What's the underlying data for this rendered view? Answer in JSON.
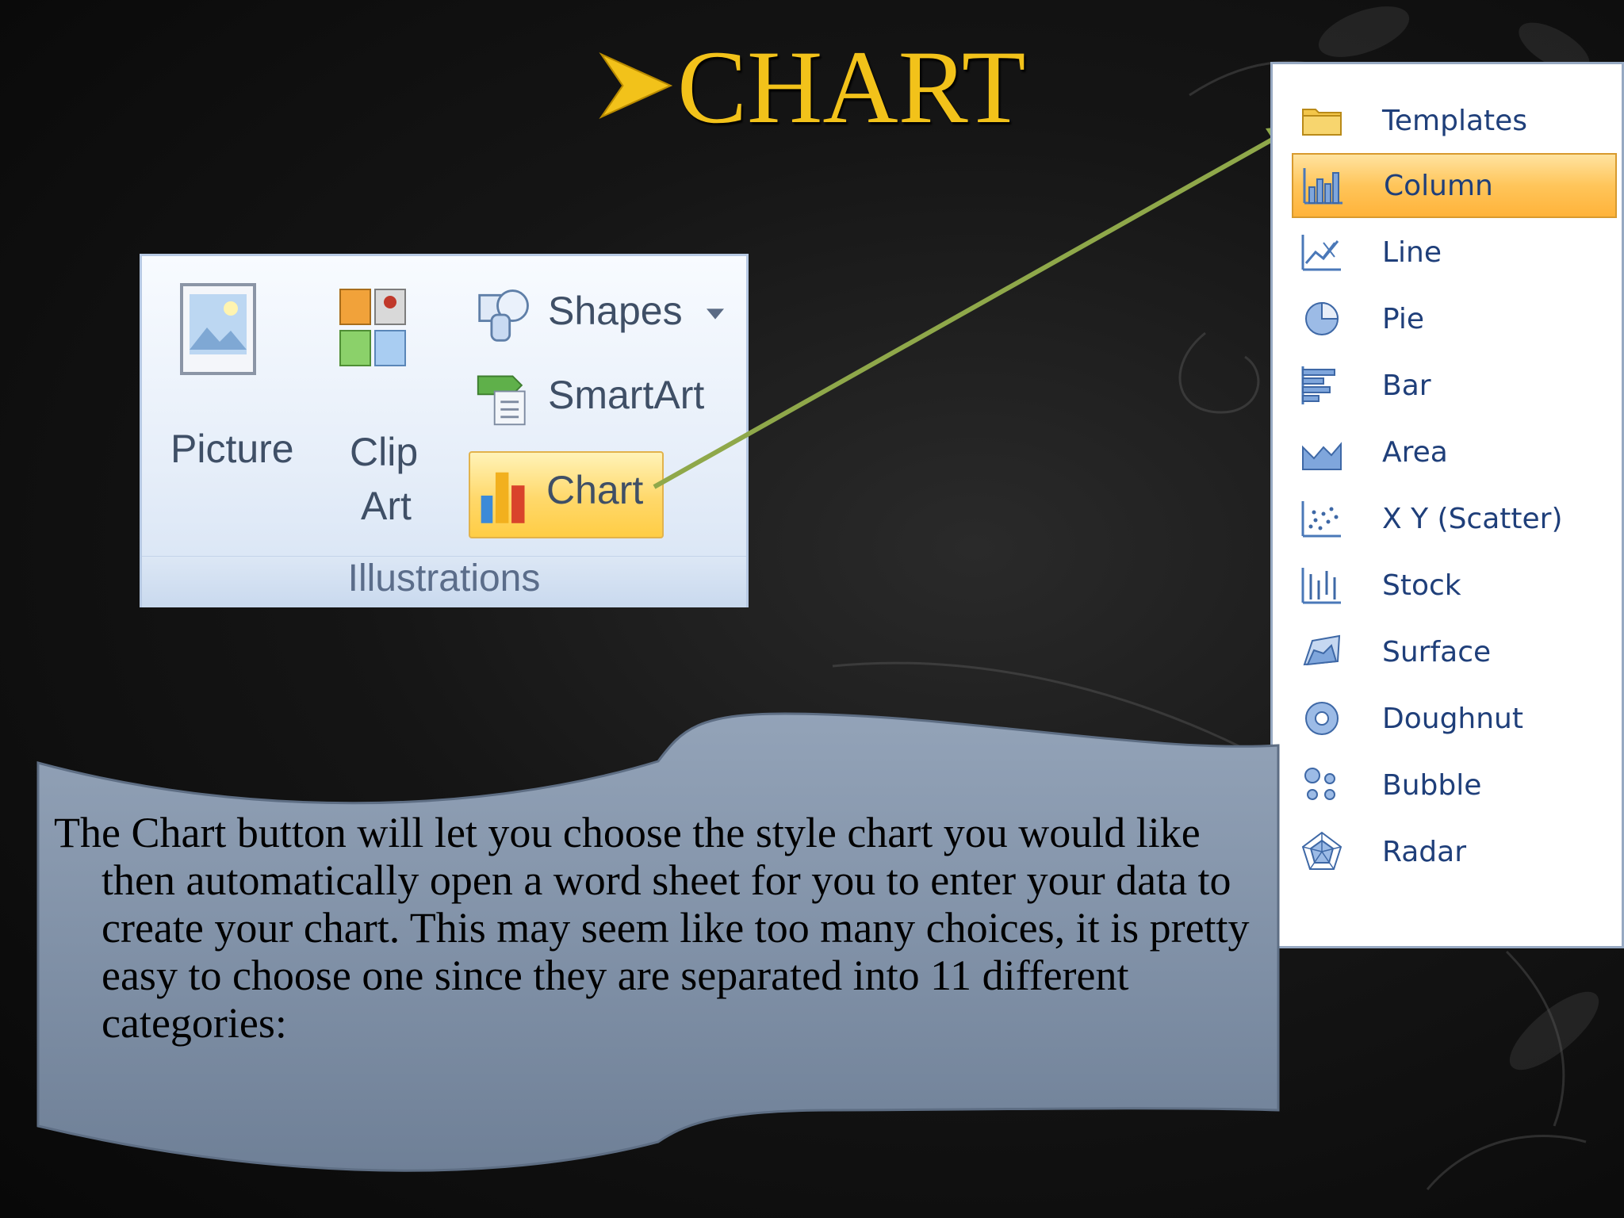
{
  "title": "CHART",
  "ribbon": {
    "picture_label": "Picture",
    "clip_label_1": "Clip",
    "clip_label_2": "Art",
    "shapes_label": "Shapes",
    "smartart_label": "SmartArt",
    "chart_label": "Chart",
    "group_label": "Illustrations"
  },
  "menu": {
    "items": [
      {
        "label": "Templates",
        "icon": "folder-icon"
      },
      {
        "label": "Column",
        "icon": "column-chart-icon"
      },
      {
        "label": "Line",
        "icon": "line-chart-icon"
      },
      {
        "label": "Pie",
        "icon": "pie-chart-icon"
      },
      {
        "label": "Bar",
        "icon": "bar-chart-icon"
      },
      {
        "label": "Area",
        "icon": "area-chart-icon"
      },
      {
        "label": "X Y (Scatter)",
        "icon": "scatter-chart-icon"
      },
      {
        "label": "Stock",
        "icon": "stock-chart-icon"
      },
      {
        "label": "Surface",
        "icon": "surface-chart-icon"
      },
      {
        "label": "Doughnut",
        "icon": "doughnut-chart-icon"
      },
      {
        "label": "Bubble",
        "icon": "bubble-chart-icon"
      },
      {
        "label": "Radar",
        "icon": "radar-chart-icon"
      }
    ],
    "selected": "Column"
  },
  "banner": {
    "text": "The Chart button will let you choose the style chart you would like then automatically open a word sheet for you to enter your data to create your chart. This may seem like too many choices, it is pretty easy to choose one since they are separated into 11 different categories:"
  },
  "colors": {
    "title": "#f2c21a",
    "banner": "#8393a8",
    "arrow": "#8fa84a",
    "menu_highlight": "#ffc55a",
    "menu_text": "#1f3f7a"
  }
}
